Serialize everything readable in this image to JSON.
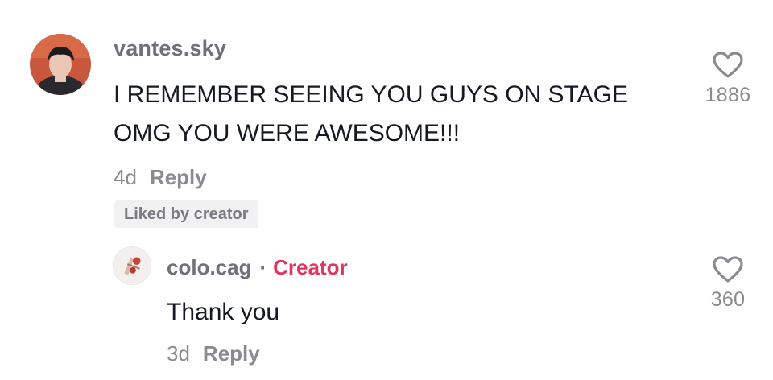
{
  "comments": [
    {
      "username": "vantes.sky",
      "text": "I REMEMBER SEEING YOU GUYS ON STAGE OMG YOU WERE AWESOME!!!",
      "time": "4d",
      "reply_label": "Reply",
      "badge": "Liked by creator",
      "likes": "1886"
    }
  ],
  "replies": [
    {
      "username": "colo.cag",
      "separator": "·",
      "creator_label": "Creator",
      "text": "Thank you",
      "time": "3d",
      "reply_label": "Reply",
      "likes": "360"
    }
  ],
  "icons": {
    "like": "heart-outline-icon",
    "avatar_main": "user-avatar",
    "avatar_reply": "creator-avatar"
  },
  "colors": {
    "creator": "#e0355d",
    "meta": "#8a8b91",
    "badge_bg": "#f1f1f2"
  }
}
